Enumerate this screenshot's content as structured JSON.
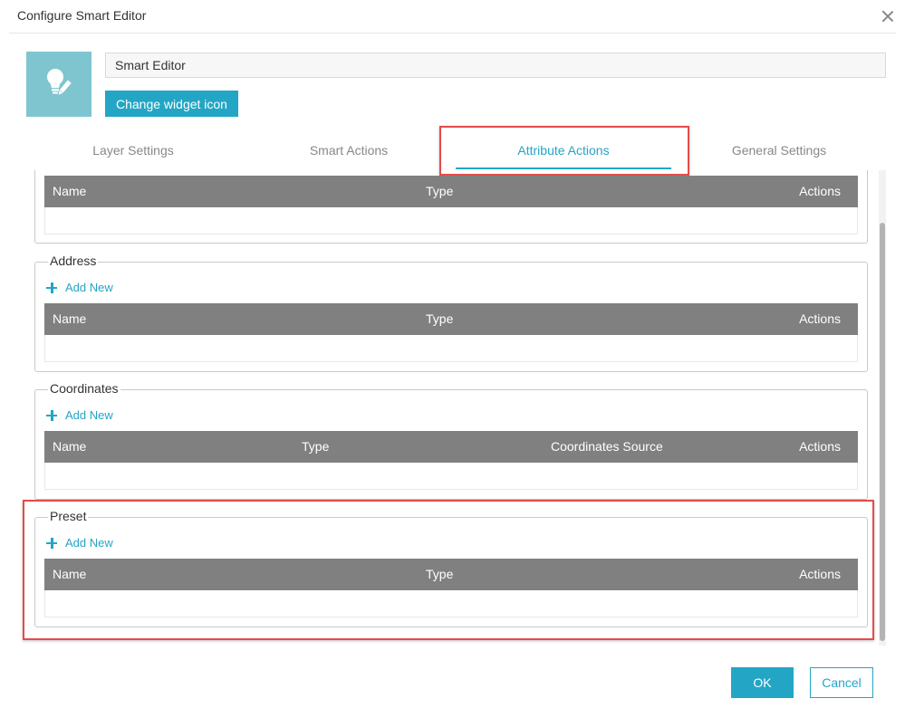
{
  "dialog": {
    "title": "Configure Smart Editor"
  },
  "widget": {
    "name_value": "Smart Editor",
    "change_icon_label": "Change widget icon"
  },
  "tabs": [
    {
      "label": "Layer Settings"
    },
    {
      "label": "Smart Actions"
    },
    {
      "label": "Attribute Actions"
    },
    {
      "label": "General Settings"
    }
  ],
  "active_tab": "Attribute Actions",
  "sections": {
    "top": {
      "columns": [
        "Name",
        "Type",
        "Actions"
      ]
    },
    "address": {
      "legend": "Address",
      "add_label": "Add New",
      "columns": [
        "Name",
        "Type",
        "Actions"
      ]
    },
    "coordinates": {
      "legend": "Coordinates",
      "add_label": "Add New",
      "columns": [
        "Name",
        "Type",
        "Coordinates Source",
        "Actions"
      ]
    },
    "preset": {
      "legend": "Preset",
      "add_label": "Add New",
      "columns": [
        "Name",
        "Type",
        "Actions"
      ]
    }
  },
  "footer": {
    "ok_label": "OK",
    "cancel_label": "Cancel"
  },
  "colors": {
    "accent": "#23a6c5",
    "header_gray": "#808080",
    "highlight_red": "#e54b4b",
    "icon_tile": "#7fc5cf"
  }
}
